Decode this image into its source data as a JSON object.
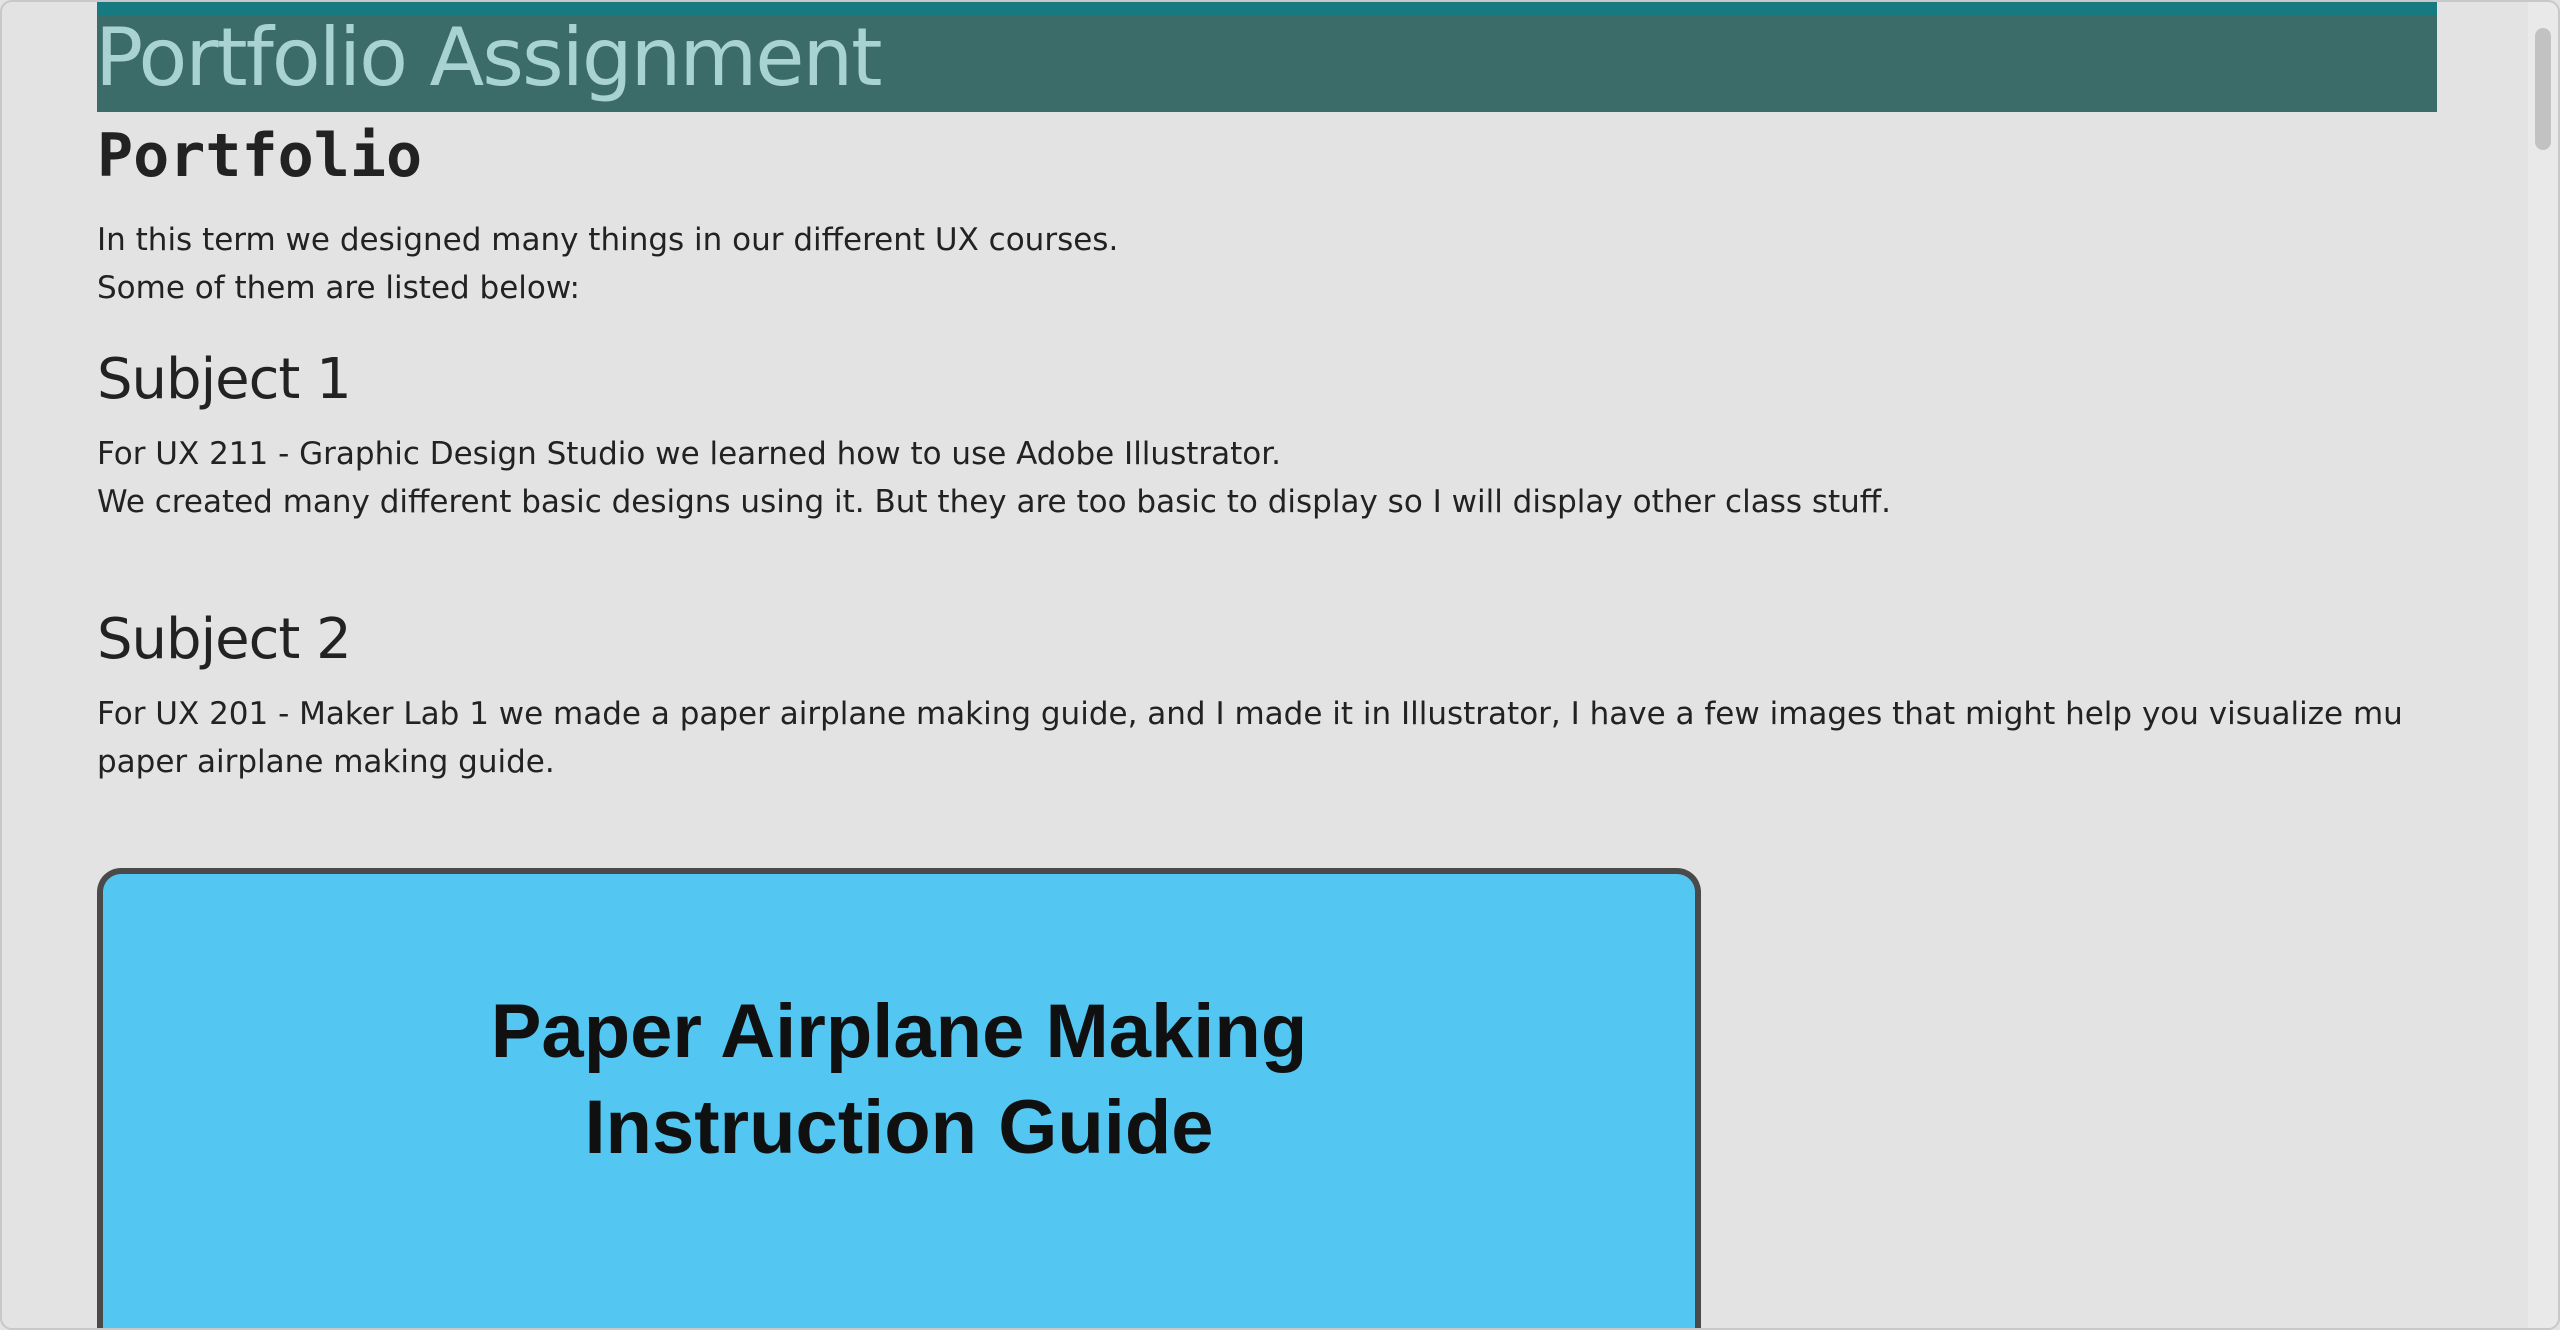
{
  "header": {
    "title": "Portfolio Assignment"
  },
  "main": {
    "heading": "Portfolio",
    "intro_lines": [
      "In this term we designed many things in our different UX courses.",
      "Some of them are listed below:"
    ],
    "subjects": [
      {
        "heading": "Subject 1",
        "lines": [
          "For UX 211 - Graphic Design Studio we learned how to use Adobe Illustrator.",
          "We created many different basic designs using it. But they are too basic to display so I will display other class stuff."
        ]
      },
      {
        "heading": "Subject 2",
        "lines": [
          "For UX 201 - Maker Lab 1 we made a paper airplane making guide, and I made it in Illustrator, I have a few images that might help you visualize mu paper airplane making guide."
        ]
      }
    ],
    "guide_image": {
      "title_line1": "Paper Airplane Making",
      "title_line2": "Instruction Guide"
    }
  },
  "colors": {
    "page_background": "#e3e3e3",
    "header_background": "#3b6c69",
    "header_accent": "#167a80",
    "header_text": "#a9d2d3",
    "guide_background": "#54c6f2"
  }
}
